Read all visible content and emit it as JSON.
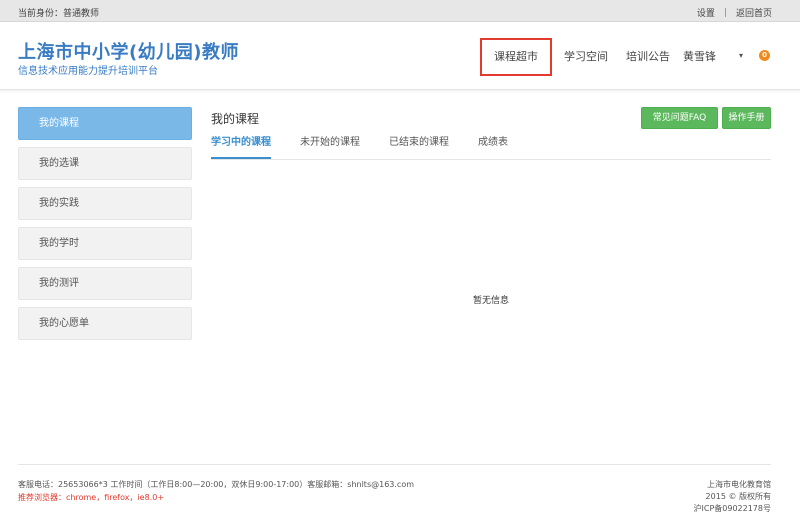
{
  "topbar": {
    "identity": "当前身份：普通教师",
    "settings": "设置",
    "separator": "|",
    "home": "返回首页"
  },
  "header": {
    "title": "上海市中小学(幼儿园)教师",
    "subtitle": "信息技术应用能力提升培训平台",
    "nav": [
      "课程超市",
      "学习空间",
      "培训公告"
    ],
    "user": "黄雪锋",
    "caret": "▾",
    "badge": "0"
  },
  "sidebar": {
    "items": [
      "我的课程",
      "我的选课",
      "我的实践",
      "我的学时",
      "我的测评",
      "我的心愿单"
    ]
  },
  "main": {
    "title": "我的课程",
    "faq_button": "常见问题FAQ",
    "manual_button": "操作手册",
    "tabs": [
      "学习中的课程",
      "未开始的课程",
      "已结束的课程",
      "成绩表"
    ],
    "empty": "暂无信息"
  },
  "footer": {
    "contact": "客服电话：25653066*3 工作时间（工作日8:00—20:00，双休日9:00-17:00）客服邮箱：shnlts@163.com",
    "browser": "推荐浏览器：chrome，firefox，ie8.0+",
    "org": "上海市电化教育馆",
    "copyright": "2015 © 版权所有",
    "icp": "沪ICP备09022178号"
  },
  "colors": {
    "brand": "#3a7cc4",
    "active_sidebar": "#7ab8e8",
    "button_green": "#5cb85c",
    "highlight_border": "#e23a2c",
    "badge": "#f08a1c"
  }
}
